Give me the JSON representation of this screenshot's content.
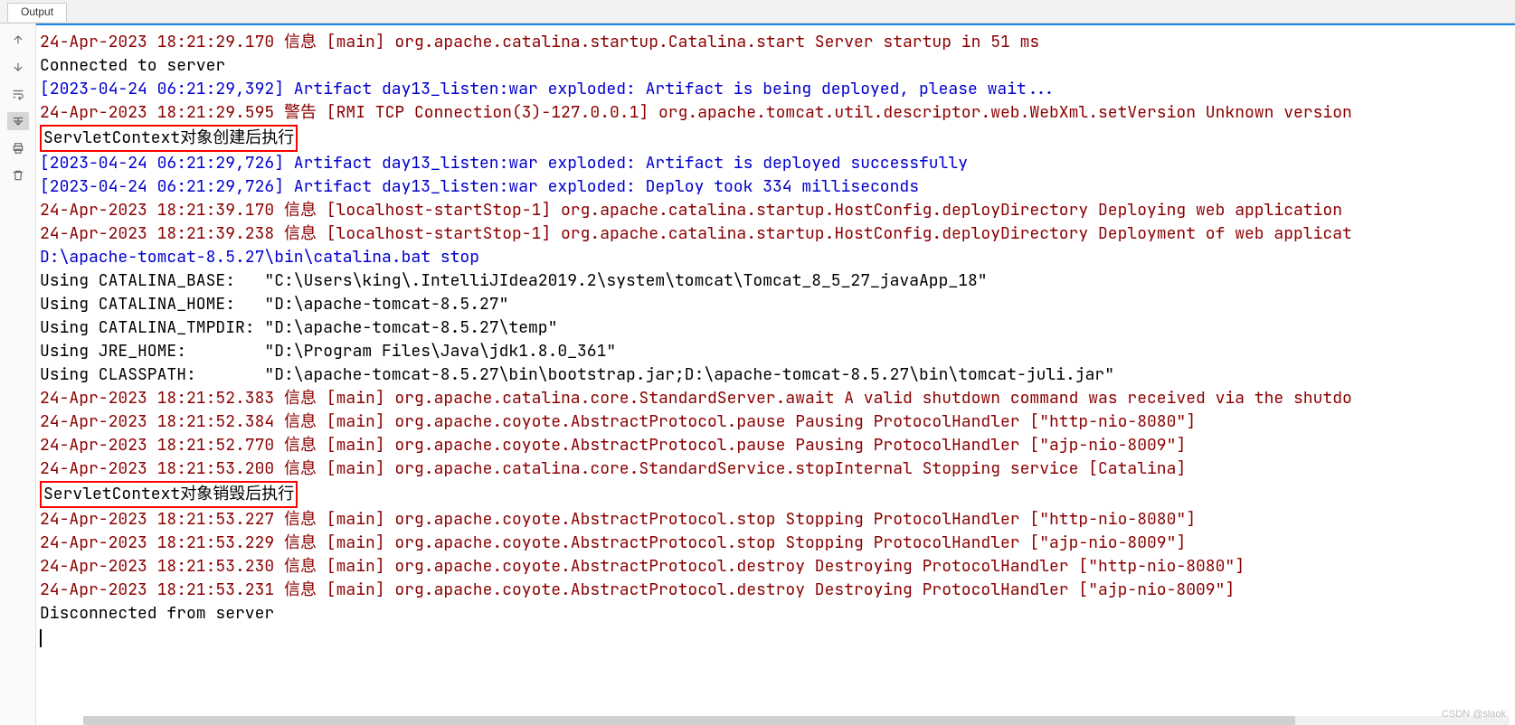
{
  "tab": {
    "label": "Output"
  },
  "gutter": {
    "up": "arrow-up",
    "down": "arrow-down",
    "soft_wrap": "soft-wrap",
    "scroll_end": "scroll-to-end",
    "print": "print",
    "clear": "clear"
  },
  "highlight1": "ServletContext对象创建后执行",
  "highlight2": "ServletContext对象销毁后执行",
  "log": {
    "l1": "24-Apr-2023 18:21:29.170 信息 [main] org.apache.catalina.startup.Catalina.start Server startup in 51 ms",
    "l2": "Connected to server",
    "l3": "[2023-04-24 06:21:29,392] Artifact day13_listen:war exploded: Artifact is being deployed, please wait...",
    "l4": "24-Apr-2023 18:21:29.595 警告 [RMI TCP Connection(3)-127.0.0.1] org.apache.tomcat.util.descriptor.web.WebXml.setVersion Unknown version",
    "l6": "[2023-04-24 06:21:29,726] Artifact day13_listen:war exploded: Artifact is deployed successfully",
    "l7": "[2023-04-24 06:21:29,726] Artifact day13_listen:war exploded: Deploy took 334 milliseconds",
    "l8": "24-Apr-2023 18:21:39.170 信息 [localhost-startStop-1] org.apache.catalina.startup.HostConfig.deployDirectory Deploying web application",
    "l9": "24-Apr-2023 18:21:39.238 信息 [localhost-startStop-1] org.apache.catalina.startup.HostConfig.deployDirectory Deployment of web applicat",
    "l10": "D:\\apache-tomcat-8.5.27\\bin\\catalina.bat stop",
    "l11": "Using CATALINA_BASE:   \"C:\\Users\\king\\.IntelliJIdea2019.2\\system\\tomcat\\Tomcat_8_5_27_javaApp_18\"",
    "l12": "Using CATALINA_HOME:   \"D:\\apache-tomcat-8.5.27\"",
    "l13": "Using CATALINA_TMPDIR: \"D:\\apache-tomcat-8.5.27\\temp\"",
    "l14": "Using JRE_HOME:        \"D:\\Program Files\\Java\\jdk1.8.0_361\"",
    "l15": "Using CLASSPATH:       \"D:\\apache-tomcat-8.5.27\\bin\\bootstrap.jar;D:\\apache-tomcat-8.5.27\\bin\\tomcat-juli.jar\"",
    "l16": "24-Apr-2023 18:21:52.383 信息 [main] org.apache.catalina.core.StandardServer.await A valid shutdown command was received via the shutdo",
    "l17": "24-Apr-2023 18:21:52.384 信息 [main] org.apache.coyote.AbstractProtocol.pause Pausing ProtocolHandler [\"http-nio-8080\"]",
    "l18": "24-Apr-2023 18:21:52.770 信息 [main] org.apache.coyote.AbstractProtocol.pause Pausing ProtocolHandler [\"ajp-nio-8009\"]",
    "l19": "24-Apr-2023 18:21:53.200 信息 [main] org.apache.catalina.core.StandardService.stopInternal Stopping service [Catalina]",
    "l21": "24-Apr-2023 18:21:53.227 信息 [main] org.apache.coyote.AbstractProtocol.stop Stopping ProtocolHandler [\"http-nio-8080\"]",
    "l22": "24-Apr-2023 18:21:53.229 信息 [main] org.apache.coyote.AbstractProtocol.stop Stopping ProtocolHandler [\"ajp-nio-8009\"]",
    "l23": "24-Apr-2023 18:21:53.230 信息 [main] org.apache.coyote.AbstractProtocol.destroy Destroying ProtocolHandler [\"http-nio-8080\"]",
    "l24": "24-Apr-2023 18:21:53.231 信息 [main] org.apache.coyote.AbstractProtocol.destroy Destroying ProtocolHandler [\"ajp-nio-8009\"]",
    "l25": "Disconnected from server"
  },
  "watermark": "CSDN @slaok"
}
